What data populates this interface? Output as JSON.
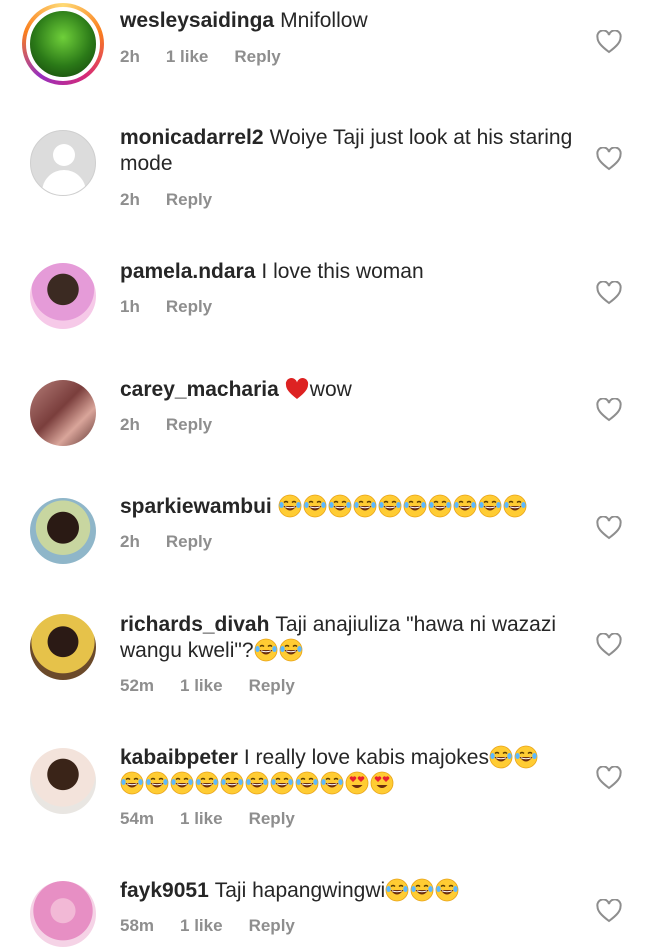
{
  "comments": [
    {
      "username": "wesleysaidinga",
      "text": "Mnifollow",
      "time": "2h",
      "likes": "1 like",
      "reply": "Reply"
    },
    {
      "username": "monicadarrel2",
      "text": "Woiye Taji just look at his staring mode",
      "time": "2h",
      "likes": "",
      "reply": "Reply"
    },
    {
      "username": "pamela.ndara",
      "text": "I love this woman",
      "time": "1h",
      "likes": "",
      "reply": "Reply"
    },
    {
      "username": "carey_macharia",
      "text": "wow",
      "time": "2h",
      "likes": "",
      "reply": "Reply"
    },
    {
      "username": "sparkiewambui",
      "text": "",
      "time": "2h",
      "likes": "",
      "reply": "Reply"
    },
    {
      "username": "richards_divah",
      "text": "Taji anajiuliza \"hawa ni wazazi wangu kweli\"?",
      "time": "52m",
      "likes": "1 like",
      "reply": "Reply"
    },
    {
      "username": "kabaibpeter",
      "text": "I really love kabis majokes",
      "time": "54m",
      "likes": "1 like",
      "reply": "Reply"
    },
    {
      "username": "fayk9051",
      "text": "Taji hapangwingwi",
      "time": "58m",
      "likes": "1 like",
      "reply": "Reply"
    }
  ],
  "icons": {
    "heart": "heart-outline-icon",
    "laugh": "tears-of-joy-emoji",
    "hearteyes": "heart-eyes-emoji",
    "redheart": "red-heart-emoji"
  },
  "colors": {
    "username": "#262626",
    "meta": "#8e8e8e",
    "heart_outline": "#8e8e8e"
  }
}
